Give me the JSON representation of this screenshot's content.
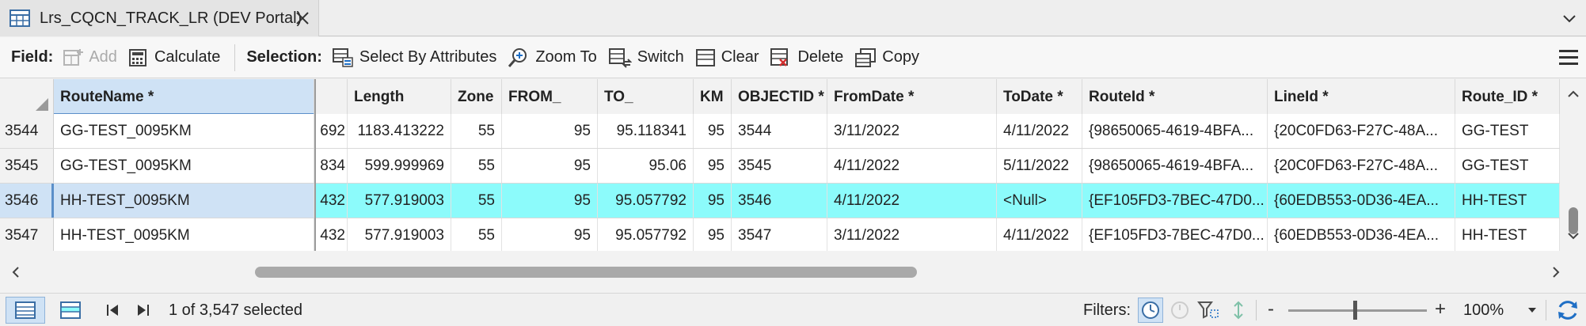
{
  "tab": {
    "title": "Lrs_CQCN_TRACK_LR (DEV Portal)",
    "icon": "table-icon"
  },
  "toolbar": {
    "field_label": "Field:",
    "add_label": "Add",
    "calculate_label": "Calculate",
    "selection_label": "Selection:",
    "select_by_attributes_label": "Select By Attributes",
    "zoom_to_label": "Zoom To",
    "switch_label": "Switch",
    "clear_label": "Clear",
    "delete_label": "Delete",
    "copy_label": "Copy"
  },
  "table": {
    "columns": [
      "RouteName *",
      "",
      "Length",
      "Zone",
      "FROM_",
      "TO_",
      "KM",
      "OBJECTID *",
      "FromDate *",
      "ToDate *",
      "RouteId *",
      "LineId *",
      "Route_ID *"
    ],
    "rows": [
      {
        "rownum": "3544",
        "cells": [
          "GG-TEST_0095KM",
          "692",
          "1183.413222",
          "55",
          "95",
          "95.118341",
          "95",
          "3544",
          "3/11/2022",
          "4/11/2022",
          "{98650065-4619-4BFA...",
          "{20C0FD63-F27C-48A...",
          "GG-TEST"
        ]
      },
      {
        "rownum": "3545",
        "cells": [
          "GG-TEST_0095KM",
          "834",
          "599.999969",
          "55",
          "95",
          "95.06",
          "95",
          "3545",
          "4/11/2022",
          "5/11/2022",
          "{98650065-4619-4BFA...",
          "{20C0FD63-F27C-48A...",
          "GG-TEST"
        ]
      },
      {
        "rownum": "3546",
        "cells": [
          "HH-TEST_0095KM",
          "432",
          "577.919003",
          "55",
          "95",
          "95.057792",
          "95",
          "3546",
          "4/11/2022",
          "<Null>",
          "{EF105FD3-7BEC-47D0...",
          "{60EDB553-0D36-4EA...",
          "HH-TEST"
        ]
      },
      {
        "rownum": "3547",
        "cells": [
          "HH-TEST_0095KM",
          "432",
          "577.919003",
          "55",
          "95",
          "95.057792",
          "95",
          "3547",
          "3/11/2022",
          "4/11/2022",
          "{EF105FD3-7BEC-47D0...",
          "{60EDB553-0D36-4EA...",
          "HH-TEST"
        ]
      }
    ],
    "highlighted_row": 2
  },
  "status": {
    "selection_text": "1 of 3,547 selected",
    "filters_label": "Filters:",
    "zoom_value": "100%",
    "zoom_minus": "-",
    "zoom_plus": "+",
    "zoom_level": 0.48
  },
  "colors": {
    "highlight_row": "#8cfbfb",
    "selected_column": "#cfe2f5",
    "selected_border": "#5b8fc9",
    "accent_blue": "#1f6fc5"
  }
}
